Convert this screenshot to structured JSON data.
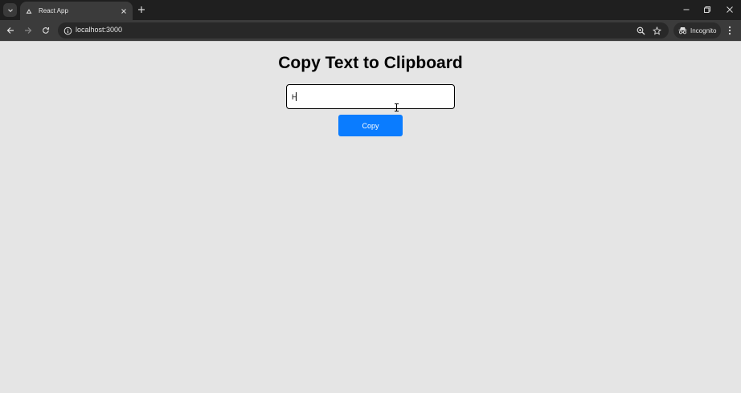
{
  "browser": {
    "tab": {
      "title": "React App"
    },
    "address_bar": {
      "url": "localhost:3000"
    },
    "incognito_label": "Incognito"
  },
  "page": {
    "title": "Copy Text to Clipboard",
    "input": {
      "value": "H"
    },
    "copy_button_label": "Copy"
  },
  "colors": {
    "tabstrip_bg": "#1f1f1f",
    "toolbar_bg": "#3b3b3b",
    "page_bg": "#e5e5e5",
    "button_bg": "#0a7cff"
  }
}
